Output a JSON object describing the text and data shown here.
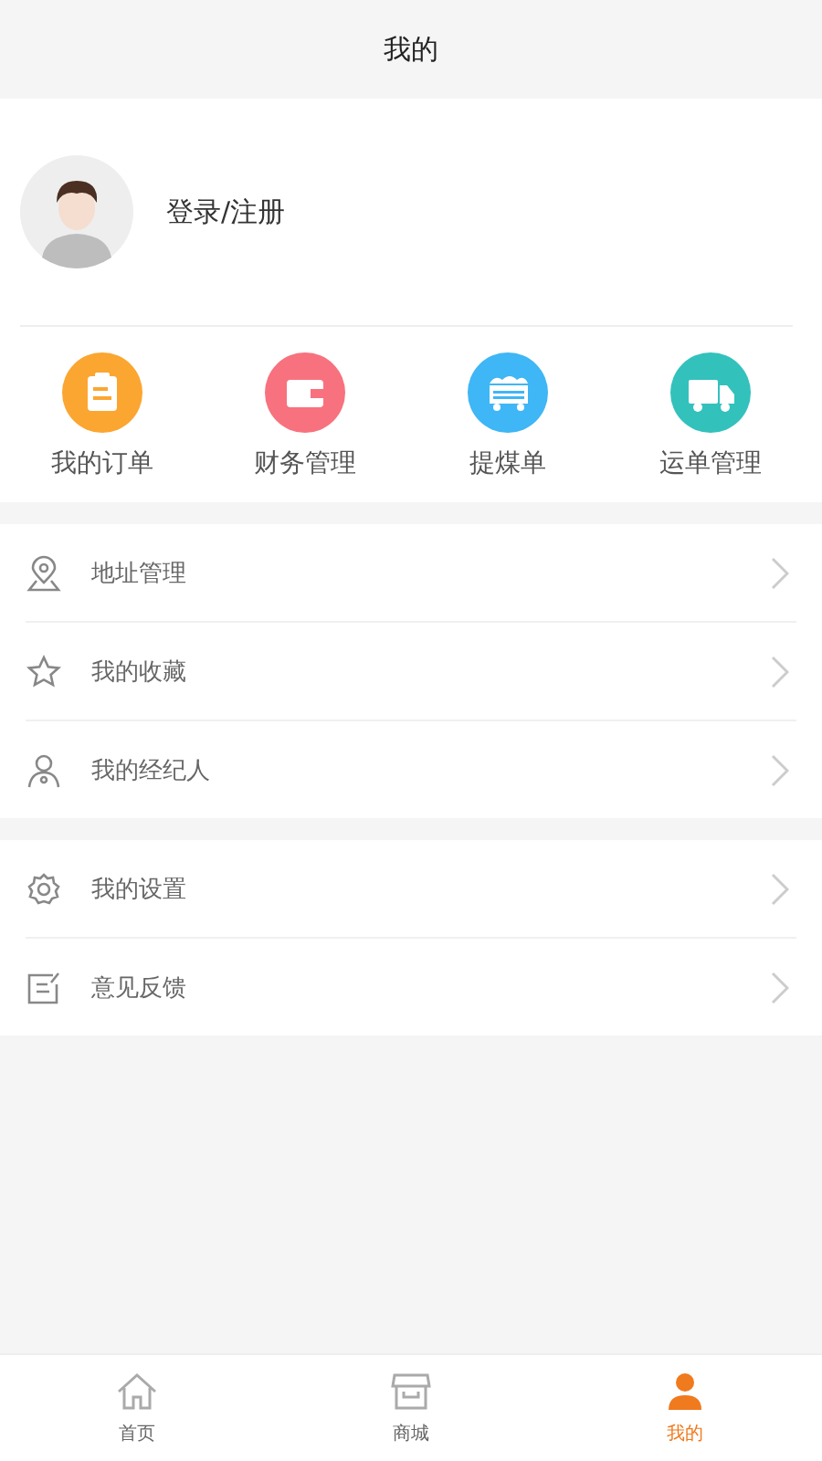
{
  "header": {
    "title": "我的"
  },
  "profile": {
    "login_label": "登录/注册"
  },
  "shortcuts": [
    {
      "label": "我的订单",
      "kind": "clipboard",
      "color": "#fba631"
    },
    {
      "label": "财务管理",
      "kind": "wallet",
      "color": "#f7727e"
    },
    {
      "label": "提煤单",
      "kind": "cart",
      "color": "#3fb6f5"
    },
    {
      "label": "运单管理",
      "kind": "truck",
      "color": "#33c1bc"
    }
  ],
  "menu_groups": [
    [
      {
        "label": "地址管理",
        "kind": "location"
      },
      {
        "label": "我的收藏",
        "kind": "star"
      },
      {
        "label": "我的经纪人",
        "kind": "person"
      }
    ],
    [
      {
        "label": "我的设置",
        "kind": "gear"
      },
      {
        "label": "意见反馈",
        "kind": "feedback"
      }
    ]
  ],
  "tab_bar": [
    {
      "label": "首页",
      "kind": "home",
      "selected": false
    },
    {
      "label": "商城",
      "kind": "store",
      "selected": false
    },
    {
      "label": "我的",
      "kind": "user",
      "selected": true
    }
  ]
}
